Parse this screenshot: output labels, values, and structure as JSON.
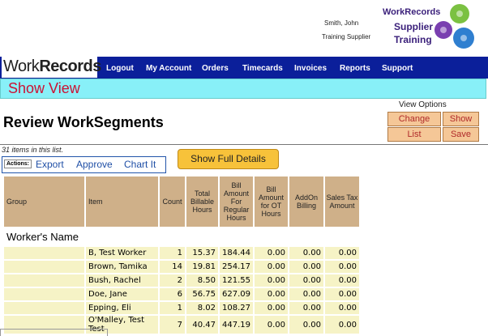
{
  "header": {
    "user_name": "Smith, John",
    "user_company": "Training Supplier",
    "brand": [
      "WorkRecords",
      "Supplier",
      "Training"
    ]
  },
  "nav": {
    "logo_plain": "Work",
    "logo_bold": "Records",
    "items": [
      "Logout",
      "My Account",
      "Orders",
      "Timecards",
      "Invoices",
      "Reports",
      "Support"
    ]
  },
  "view_bar": {
    "label": "Show View"
  },
  "page": {
    "title": "Review WorkSegments"
  },
  "view_options": {
    "label": "View Options",
    "buttons": [
      "Change",
      "Show",
      "List",
      "Save"
    ]
  },
  "list": {
    "count_text": "31 items in this list.",
    "actions_label": "Actions:",
    "actions": [
      "Export",
      "Approve",
      "Chart It"
    ],
    "full_details": "Show Full Details"
  },
  "table": {
    "headers": [
      "Group",
      "Item",
      "Count",
      "Total Billable Hours",
      "Bill Amount For Regular Hours",
      "Bill Amount for OT Hours",
      "AddOn Billing",
      "Sales Tax Amount"
    ],
    "group_label": "Worker's Name",
    "rows": [
      [
        "",
        "B, Test Worker",
        "1",
        "15.37",
        "184.44",
        "0.00",
        "0.00",
        "0.00"
      ],
      [
        "",
        "Brown, Tamika",
        "14",
        "19.81",
        "254.17",
        "0.00",
        "0.00",
        "0.00"
      ],
      [
        "",
        "Bush, Rachel",
        "2",
        "8.50",
        "121.55",
        "0.00",
        "0.00",
        "0.00"
      ],
      [
        "",
        "Doe, Jane",
        "6",
        "56.75",
        "627.09",
        "0.00",
        "0.00",
        "0.00"
      ],
      [
        "",
        "Epping, Eli",
        "1",
        "8.02",
        "108.27",
        "0.00",
        "0.00",
        "0.00"
      ],
      [
        "",
        "O'Malley, Test Test",
        "7",
        "40.47",
        "447.19",
        "0.00",
        "0.00",
        "0.00"
      ]
    ]
  },
  "colors": {
    "nav_bg": "#0b1f9a",
    "view_bar_bg": "#88f0f8",
    "header_cell": "#cfb089",
    "data_cell": "#f6f3c6",
    "accent_button": "#f7c23a"
  }
}
